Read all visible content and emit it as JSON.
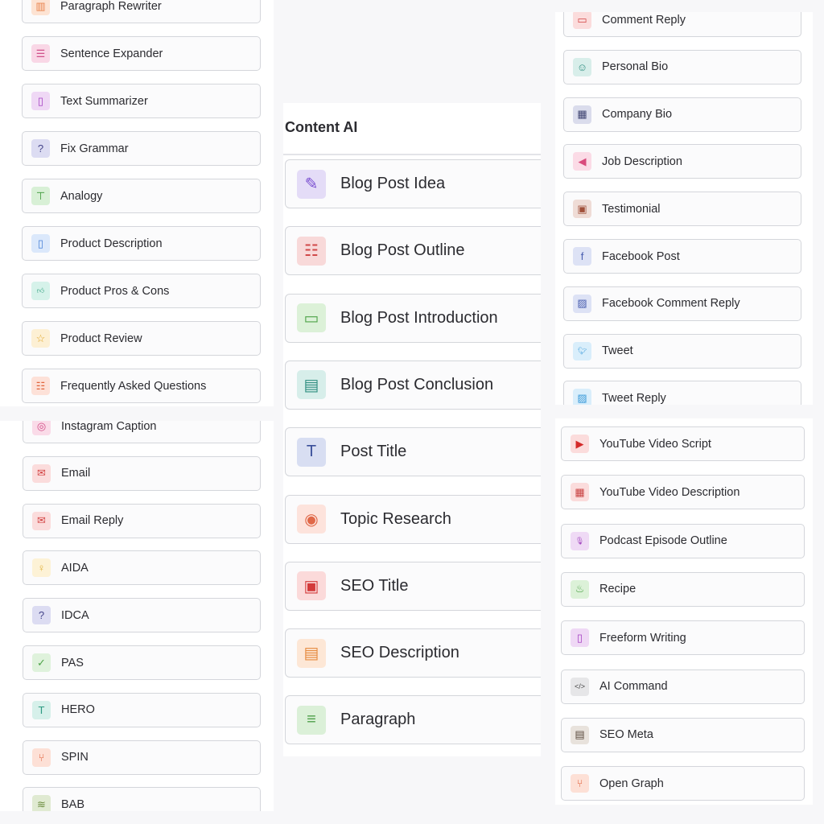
{
  "left_top": {
    "items": [
      {
        "label": "Paragraph Rewriter",
        "icon": "book-icon",
        "glyph": "▥",
        "bg": "#fde3d3",
        "fg": "#e8834e"
      },
      {
        "label": "Sentence Expander",
        "icon": "list-circle-icon",
        "glyph": "☰",
        "bg": "#f9d7e6",
        "fg": "#d0508a"
      },
      {
        "label": "Text Summarizer",
        "icon": "note-icon",
        "glyph": "▯",
        "bg": "#efd8f5",
        "fg": "#a33fc2"
      },
      {
        "label": "Fix Grammar",
        "icon": "question-icon",
        "glyph": "?",
        "bg": "#dcdcf2",
        "fg": "#45458a"
      },
      {
        "label": "Analogy",
        "icon": "hierarchy-icon",
        "glyph": "⊤",
        "bg": "#d8f0d6",
        "fg": "#3d9a3a"
      },
      {
        "label": "Product Description",
        "icon": "phone-icon",
        "glyph": "▯",
        "bg": "#dbe8fb",
        "fg": "#4a82d8"
      },
      {
        "label": "Product Pros & Cons",
        "icon": "thumbs-up-icon",
        "glyph": "👍︎",
        "bg": "#d6f2ea",
        "fg": "#2fa07e"
      },
      {
        "label": "Product Review",
        "icon": "star-icon",
        "glyph": "☆",
        "bg": "#fdf0d4",
        "fg": "#e0a629"
      },
      {
        "label": "Frequently Asked Questions",
        "icon": "list-icon",
        "glyph": "☷",
        "bg": "#fde1d8",
        "fg": "#e0643c"
      }
    ]
  },
  "left_bottom": {
    "items": [
      {
        "label": "Instagram Caption",
        "icon": "instagram-icon",
        "glyph": "◎",
        "bg": "#fadbe8",
        "fg": "#d24a86"
      },
      {
        "label": "Email",
        "icon": "mail-icon",
        "glyph": "✉",
        "bg": "#fbdcdc",
        "fg": "#d34545"
      },
      {
        "label": "Email Reply",
        "icon": "mail-reply-icon",
        "glyph": "✉",
        "bg": "#fbdcdc",
        "fg": "#d34545"
      },
      {
        "label": "AIDA",
        "icon": "lightbulb-icon",
        "glyph": "♀",
        "bg": "#fdf2d6",
        "fg": "#e2b23a"
      },
      {
        "label": "IDCA",
        "icon": "question-icon",
        "glyph": "?",
        "bg": "#dcdcf2",
        "fg": "#45458a"
      },
      {
        "label": "PAS",
        "icon": "check-icon",
        "glyph": "✓",
        "bg": "#dff2dc",
        "fg": "#4ea349"
      },
      {
        "label": "HERO",
        "icon": "text-icon",
        "glyph": "T",
        "bg": "#d6f0ea",
        "fg": "#2d9a82"
      },
      {
        "label": "SPIN",
        "icon": "graph-icon",
        "glyph": "⑂",
        "bg": "#fde0d6",
        "fg": "#e0603a"
      },
      {
        "label": "BAB",
        "icon": "database-icon",
        "glyph": "≋",
        "bg": "#e0ead2",
        "fg": "#6b8c3e"
      }
    ]
  },
  "content_ai": {
    "title": "Content AI",
    "items": [
      {
        "label": "Blog Post Idea",
        "icon": "edit-icon",
        "glyph": "✎",
        "bg": "#e4dcf7",
        "fg": "#7a4fd0"
      },
      {
        "label": "Blog Post Outline",
        "icon": "list-icon",
        "glyph": "☷",
        "bg": "#f8d9d9",
        "fg": "#d04848"
      },
      {
        "label": "Blog Post Introduction",
        "icon": "monitor-icon",
        "glyph": "▭",
        "bg": "#dcf1d8",
        "fg": "#4ea349"
      },
      {
        "label": "Blog Post Conclusion",
        "icon": "message-icon",
        "glyph": "▤",
        "bg": "#d7eeea",
        "fg": "#2f8e80"
      },
      {
        "label": "Post Title",
        "icon": "text-icon",
        "glyph": "T",
        "bg": "#d8def2",
        "fg": "#3a4f9a"
      },
      {
        "label": "Topic Research",
        "icon": "eye-scan-icon",
        "glyph": "◉",
        "bg": "#fde3dc",
        "fg": "#e06848"
      },
      {
        "label": "SEO Title",
        "icon": "window-icon",
        "glyph": "▣",
        "bg": "#fbdada",
        "fg": "#d33b3b"
      },
      {
        "label": "SEO Description",
        "icon": "layout-icon",
        "glyph": "▤",
        "bg": "#fde7d6",
        "fg": "#e68a3e"
      },
      {
        "label": "Paragraph",
        "icon": "paragraph-icon",
        "glyph": "≡",
        "bg": "#dbf0d8",
        "fg": "#4d9f49"
      }
    ]
  },
  "right_top": {
    "items": [
      {
        "label": "Comment Reply",
        "icon": "comment-icon",
        "glyph": "▭",
        "bg": "#fbdcdc",
        "fg": "#d34545"
      },
      {
        "label": "Personal Bio",
        "icon": "user-icon",
        "glyph": "☺",
        "bg": "#d8eeea",
        "fg": "#2f8e80"
      },
      {
        "label": "Company Bio",
        "icon": "store-icon",
        "glyph": "▦",
        "bg": "#dadcec",
        "fg": "#3d4270"
      },
      {
        "label": "Job Description",
        "icon": "megaphone-icon",
        "glyph": "◀",
        "bg": "#fbdbe6",
        "fg": "#d94a7c"
      },
      {
        "label": "Testimonial",
        "icon": "money-icon",
        "glyph": "▣",
        "bg": "#efdcd6",
        "fg": "#a0503a"
      },
      {
        "label": "Facebook Post",
        "icon": "facebook-icon",
        "glyph": "f",
        "bg": "#dde2f5",
        "fg": "#4a5fb0"
      },
      {
        "label": "Facebook Comment Reply",
        "icon": "photo-icon",
        "glyph": "▨",
        "bg": "#dde2f5",
        "fg": "#4a5fb0"
      },
      {
        "label": "Tweet",
        "icon": "twitter-icon",
        "glyph": "🐦︎",
        "bg": "#d9eefb",
        "fg": "#3a9ad9"
      },
      {
        "label": "Tweet Reply",
        "icon": "photo-icon",
        "glyph": "▨",
        "bg": "#d9eefb",
        "fg": "#3a9ad9"
      }
    ]
  },
  "right_bottom": {
    "items": [
      {
        "label": "YouTube Video Script",
        "icon": "youtube-icon",
        "glyph": "▶",
        "bg": "#fbdcdc",
        "fg": "#d42a2a"
      },
      {
        "label": "YouTube Video Description",
        "icon": "film-icon",
        "glyph": "▦",
        "bg": "#fbdcdc",
        "fg": "#c84040"
      },
      {
        "label": "Podcast Episode Outline",
        "icon": "microphone-icon",
        "glyph": "🎙︎",
        "bg": "#efdaf5",
        "fg": "#a44ac0"
      },
      {
        "label": "Recipe",
        "icon": "chef-hat-icon",
        "glyph": "♨",
        "bg": "#dcf1d8",
        "fg": "#4ea349"
      },
      {
        "label": "Freeform Writing",
        "icon": "note-icon",
        "glyph": "▯",
        "bg": "#efd8f5",
        "fg": "#a33fc2"
      },
      {
        "label": "AI Command",
        "icon": "code-icon",
        "glyph": "</>",
        "bg": "#e6e6e8",
        "fg": "#444"
      },
      {
        "label": "SEO Meta",
        "icon": "seo-icon",
        "glyph": "▤",
        "bg": "#e8e2dc",
        "fg": "#5a4a3e"
      },
      {
        "label": "Open Graph",
        "icon": "graph-icon",
        "glyph": "⑂",
        "bg": "#fde0d6",
        "fg": "#e0603a"
      }
    ]
  }
}
